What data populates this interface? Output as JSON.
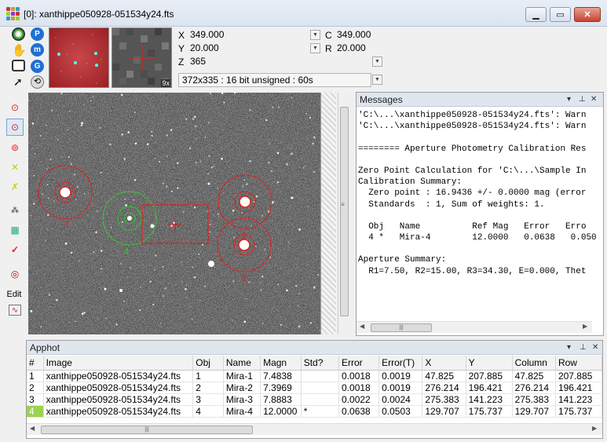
{
  "window": {
    "title": "[0]: xanthippe050928-051534y24.fts",
    "minimize": "▁",
    "maximize": "▭",
    "close": "✕"
  },
  "toolbar": {
    "zoom_thumb_badge": "9x",
    "x": {
      "label": "X",
      "value": "349.000"
    },
    "y": {
      "label": "Y",
      "value": "20.000"
    },
    "z": {
      "label": "Z",
      "value": "365"
    },
    "c": {
      "label": "C",
      "value": "349.000"
    },
    "r": {
      "label": "R",
      "value": "20.000"
    },
    "info": "372x335 : 16 bit unsigned : 60s"
  },
  "left_tools": {
    "edit_label": "Edit"
  },
  "image": {
    "marker_labels": [
      "1",
      "2",
      "3",
      "4"
    ]
  },
  "messages": {
    "title": "Messages",
    "lines": [
      "'C:\\...\\xanthippe050928-051534y24.fts': Warn",
      "'C:\\...\\xanthippe050928-051534y24.fts': Warn",
      "",
      "======== Aperture Photometry Calibration Res",
      "",
      "Zero Point Calculation for 'C:\\...\\Sample In",
      "Calibration Summary:",
      "  Zero point : 16.9436 +/- 0.0000 mag (error",
      "  Standards  : 1, Sum of weights: 1.",
      "",
      "  Obj   Name          Ref Mag   Error   Erro",
      "  4 *   Mira-4        12.0000   0.0638   0.050",
      "",
      "Aperture Summary:",
      "  R1=7.50, R2=15.00, R3=34.30, E=0.000, Thet"
    ]
  },
  "apphot": {
    "title": "Apphot",
    "columns": [
      "#",
      "Image",
      "Obj",
      "Name",
      "Magn",
      "Std?",
      "Error",
      "Error(T)",
      "X",
      "Y",
      "Column",
      "Row"
    ],
    "rows": [
      [
        "1",
        "xanthippe050928-051534y24.fts",
        "1",
        "Mira-1",
        "7.4838",
        "",
        "0.0018",
        "0.0019",
        "47.825",
        "207.885",
        "47.825",
        "207.885"
      ],
      [
        "2",
        "xanthippe050928-051534y24.fts",
        "2",
        "Mira-2",
        "7.3969",
        "",
        "0.0018",
        "0.0019",
        "276.214",
        "196.421",
        "276.214",
        "196.421"
      ],
      [
        "3",
        "xanthippe050928-051534y24.fts",
        "3",
        "Mira-3",
        "7.8883",
        "",
        "0.0022",
        "0.0024",
        "275.383",
        "141.223",
        "275.383",
        "141.223"
      ],
      [
        "4",
        "xanthippe050928-051534y24.fts",
        "4",
        "Mira-4",
        "12.0000",
        "*",
        "0.0638",
        "0.0503",
        "129.707",
        "175.737",
        "129.707",
        "175.737"
      ]
    ]
  },
  "colors": {
    "selected_row_badge": "#9ad34e",
    "red_marker": "#e02020",
    "green_marker": "#2ecc2e",
    "panel_title_bg": "#dfe6ee"
  }
}
